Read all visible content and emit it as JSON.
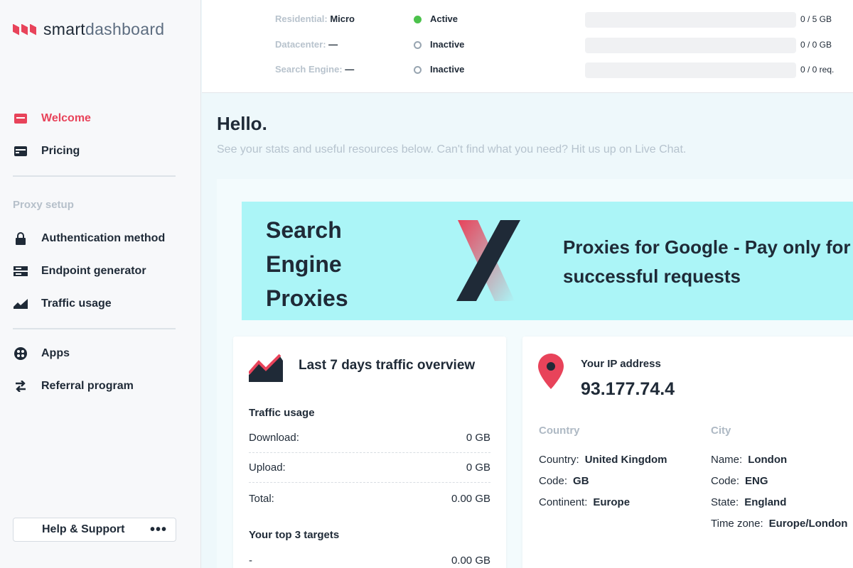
{
  "brand": {
    "part1": "smart",
    "part2": "dashboard",
    "accent": "#e8435a"
  },
  "sidebar": {
    "items_main": [
      {
        "label": "Welcome",
        "icon": "card-icon",
        "active": true
      },
      {
        "label": "Pricing",
        "icon": "wallet-icon",
        "active": false
      }
    ],
    "section_label": "Proxy setup",
    "items_proxy": [
      {
        "label": "Authentication method",
        "icon": "lock-icon"
      },
      {
        "label": "Endpoint generator",
        "icon": "server-icon"
      },
      {
        "label": "Traffic usage",
        "icon": "chart-icon"
      }
    ],
    "items_other": [
      {
        "label": "Apps",
        "icon": "apps-icon"
      },
      {
        "label": "Referral program",
        "icon": "transfer-icon"
      }
    ],
    "help": "Help & Support",
    "help_more": "•••"
  },
  "status": [
    {
      "name": "Residential:",
      "plan": "Micro",
      "state": "Active",
      "active": true,
      "amount": "0 / 5 GB"
    },
    {
      "name": "Datacenter:",
      "plan": "—",
      "state": "Inactive",
      "active": false,
      "amount": "0 / 0 GB"
    },
    {
      "name": "Search Engine:",
      "plan": "—",
      "state": "Inactive",
      "active": false,
      "amount": "0 / 0 req."
    }
  ],
  "main": {
    "greeting": "Hello.",
    "subtitle": "See your stats and useful resources below. Can't find what you need? Hit us up on Live Chat."
  },
  "banner": {
    "title_lines": [
      "Search",
      "Engine",
      "Proxies"
    ],
    "text": "Proxies for Google - Pay only for successful requests"
  },
  "traffic": {
    "title": "Last 7 days traffic overview",
    "usage_heading": "Traffic usage",
    "rows": [
      {
        "label": "Download:",
        "value": "0 GB"
      },
      {
        "label": "Upload:",
        "value": "0 GB"
      },
      {
        "label": "Total:",
        "value": "0.00 GB"
      }
    ],
    "targets_heading": "Your top 3 targets",
    "targets": [
      {
        "label": "-",
        "value": "0.00 GB"
      }
    ]
  },
  "ip": {
    "label": "Your IP address",
    "value": "93.177.74.4",
    "country_heading": "Country",
    "city_heading": "City",
    "country": [
      {
        "k": "Country:",
        "v": "United Kingdom"
      },
      {
        "k": "Code:",
        "v": "GB"
      },
      {
        "k": "Continent:",
        "v": "Europe"
      }
    ],
    "city": [
      {
        "k": "Name:",
        "v": "London"
      },
      {
        "k": "Code:",
        "v": "ENG"
      },
      {
        "k": "State:",
        "v": "England"
      },
      {
        "k": "Time zone:",
        "v": "Europe/London"
      }
    ]
  }
}
